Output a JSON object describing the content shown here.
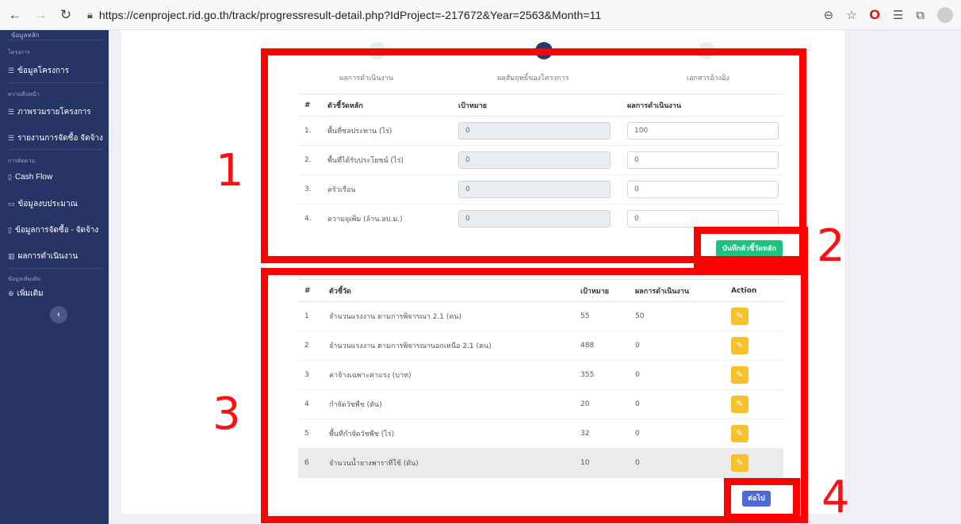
{
  "browser": {
    "url": "https://cenproject.rid.go.th/track/progressresult-detail.php?IdProject=-217672&Year=2563&Month=11"
  },
  "sidebar": {
    "top_cut": "ข้อมูลหลัก",
    "sections": [
      {
        "label": "โครงการ"
      },
      {
        "label": "ความคืบหน้า"
      },
      {
        "label": "การติดตาม"
      },
      {
        "label": "ข้อมูลเพิ่มเติม"
      }
    ],
    "items": [
      {
        "icon": "☰",
        "label": "ข้อมูลโครงการ"
      },
      {
        "icon": "☰",
        "label": "ภาพรวมรายโครงการ"
      },
      {
        "icon": "☰",
        "label": "รายงานการจัดซื้อ จัดจ้าง"
      },
      {
        "icon": "▯",
        "label": "Cash Flow"
      },
      {
        "icon": "▭",
        "label": "ข้อมูลงบประมาณ"
      },
      {
        "icon": "▯",
        "label": "ข้อมูลการจัดซื้อ - จัดจ้าง"
      },
      {
        "icon": "▥",
        "label": "ผลการดำเนินงาน"
      },
      {
        "icon": "⊕",
        "label": "เพิ่มเติม"
      }
    ],
    "collapse_icon": "‹"
  },
  "steps": [
    {
      "label": "ผลการดำเนินงาน",
      "active": false
    },
    {
      "label": "ผลสัมฤทธิ์ของโครงการ",
      "active": true
    },
    {
      "label": "เอกสารอ้างอิง",
      "active": false
    }
  ],
  "kpi_table": {
    "headers": [
      "#",
      "ตัวชี้วัดหลัก",
      "เป้าหมาย",
      "ผลการดำเนินงาน"
    ],
    "rows": [
      {
        "no": "1.",
        "name": "พื้นที่ชลประทาน (ไร่)",
        "target": "0",
        "result": "100"
      },
      {
        "no": "2.",
        "name": "พื้นที่ได้รับประโยชน์ (ไร่)",
        "target": "0",
        "result": "0"
      },
      {
        "no": "3.",
        "name": "ครัวเรือน",
        "target": "0",
        "result": "0"
      },
      {
        "no": "4.",
        "name": "ความจุเพิ่ม (ล้าน.ลบ.ม.)",
        "target": "0",
        "result": "0"
      }
    ],
    "save_label": "บันทึกตัวชี้วัดหลัก"
  },
  "indicator_table": {
    "headers": [
      "#",
      "ตัวชี้วัด",
      "เป้าหมาย",
      "ผลการดำเนินงาน",
      "Action"
    ],
    "rows": [
      {
        "no": "1",
        "name": "จำนวนแรงงาน ตามการพิจารณา 2.1 (คน)",
        "target": "55",
        "result": "50"
      },
      {
        "no": "2",
        "name": "จำนวนแรงงาน ตามการพิจารณานอกเหนือ 2.1 (คน)",
        "target": "488",
        "result": "0"
      },
      {
        "no": "3",
        "name": "ค่าจ้างเฉพาะค่าแรง (บาท)",
        "target": "355",
        "result": "0"
      },
      {
        "no": "4",
        "name": "กำจัดวัชพืช (ตัน)",
        "target": "20",
        "result": "0"
      },
      {
        "no": "5",
        "name": "พื้นที่กำจัดวัชพืช (ไร่)",
        "target": "32",
        "result": "0"
      },
      {
        "no": "6",
        "name": "จำนวนน้ำยางพาราที่ใช้ (ตัน)",
        "target": "10",
        "result": "0"
      }
    ],
    "edit_icon": "✎",
    "next_label": "ต่อไป"
  },
  "annotations": [
    "1",
    "2",
    "3",
    "4"
  ],
  "colors": {
    "annotation": "#ff0000",
    "sidebar": "#263466",
    "save_button": "#1ec27f",
    "edit_button": "#f7c12b",
    "next_button": "#4b6ad8"
  }
}
